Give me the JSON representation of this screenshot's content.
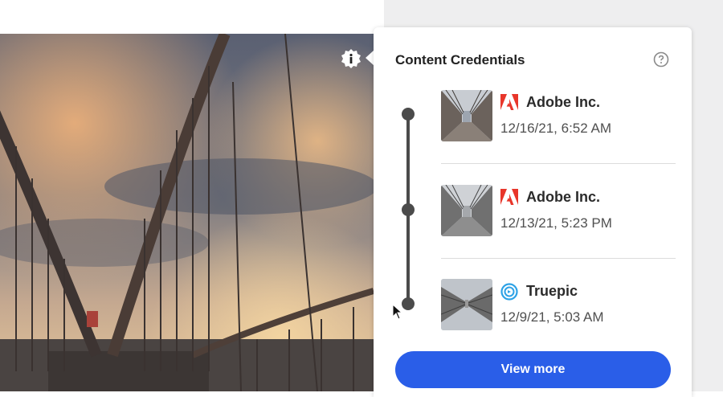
{
  "panel": {
    "title": "Content Credentials",
    "help_icon": "help-circle-icon",
    "entries": [
      {
        "issuer": "Adobe Inc.",
        "issuer_icon": "adobe-logo-icon",
        "date": "12/16/21, 6:52 AM"
      },
      {
        "issuer": "Adobe Inc.",
        "issuer_icon": "adobe-logo-icon",
        "date": "12/13/21, 5:23 PM"
      },
      {
        "issuer": "Truepic",
        "issuer_icon": "truepic-logo-icon",
        "date": "12/9/21, 5:03 AM"
      }
    ],
    "view_more_label": "View more"
  },
  "colors": {
    "accent": "#2a5ee8",
    "adobe_red": "#e8362a",
    "truepic_blue": "#2da2e6"
  }
}
